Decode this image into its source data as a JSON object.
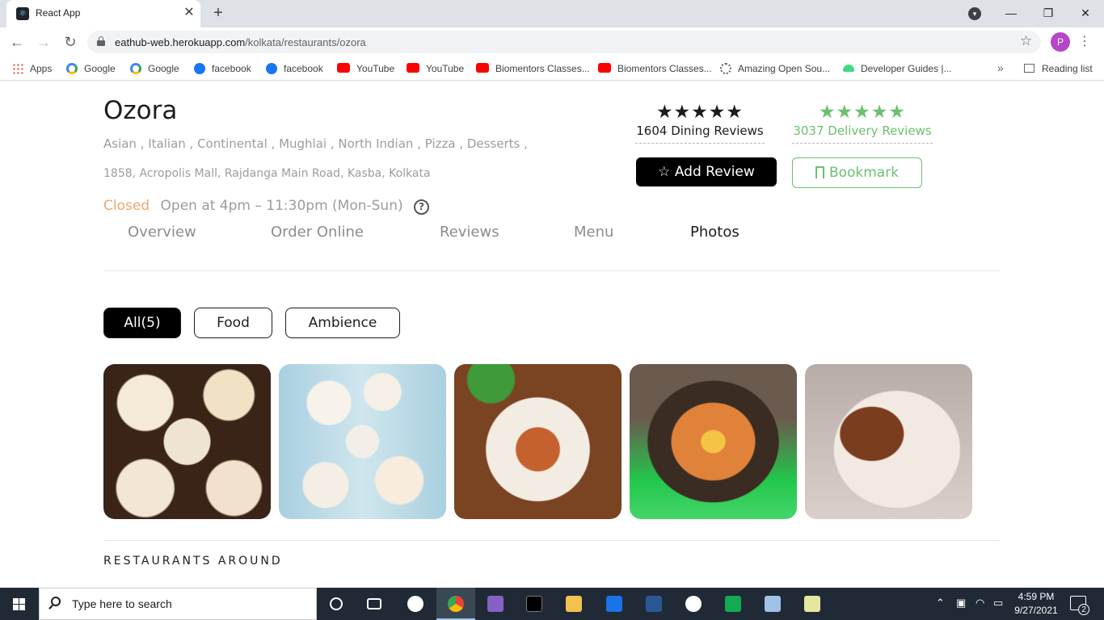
{
  "browser": {
    "tab_title": "React App",
    "url_host": "eathub-web.herokuapp.com",
    "url_path": "/kolkata/restaurants/ozora",
    "profile_initial": "P",
    "bookmarks": [
      "Apps",
      "Google",
      "Google",
      "facebook",
      "facebook",
      "YouTube",
      "YouTube",
      "Biomentors Classes...",
      "Biomentors Classes...",
      "Amazing Open Sou...",
      "Developer Guides |..."
    ],
    "bookmark_icons": [
      "apps-icon",
      "google-icon",
      "google-icon",
      "facebook-icon",
      "facebook-icon",
      "youtube-icon",
      "youtube-icon",
      "youtube-icon",
      "youtube-icon",
      "gear-icon",
      "android-icon"
    ],
    "more_bookmarks": "»",
    "reading_list": "Reading list"
  },
  "restaurant": {
    "name": "Ozora",
    "cuisines": "Asian , Italian , Continental , Mughlai , North Indian , Pizza , Desserts ,",
    "address": "1858, Acropolis Mall, Rajdanga Main Road, Kasba, Kolkata",
    "status": "Closed",
    "hours": "Open at 4pm – 11:30pm (Mon-Sun)",
    "help": "?",
    "dining": {
      "stars": 5,
      "label": "1604 Dining Reviews"
    },
    "delivery": {
      "stars": 5,
      "label": "3037 Delivery Reviews"
    },
    "add_review_label": "Add Review",
    "bookmark_label": "Bookmark"
  },
  "tabs": [
    {
      "label": "Overview",
      "active": false
    },
    {
      "label": "Order Online",
      "active": false
    },
    {
      "label": "Reviews",
      "active": false
    },
    {
      "label": "Menu",
      "active": false
    },
    {
      "label": "Photos",
      "active": true
    }
  ],
  "filters": [
    {
      "label": "All(5)",
      "active": true
    },
    {
      "label": "Food",
      "active": false
    },
    {
      "label": "Ambience",
      "active": false
    }
  ],
  "photos_count": 5,
  "section_title": "RESTAURANTS AROUND",
  "colors": {
    "accent_green": "#6cc070",
    "closed_orange": "#f4a46a",
    "dark": "#1c1c1c"
  },
  "taskbar": {
    "search_placeholder": "Type here to search",
    "time": "4:59 PM",
    "date": "9/27/2021",
    "notification_count": "2"
  }
}
